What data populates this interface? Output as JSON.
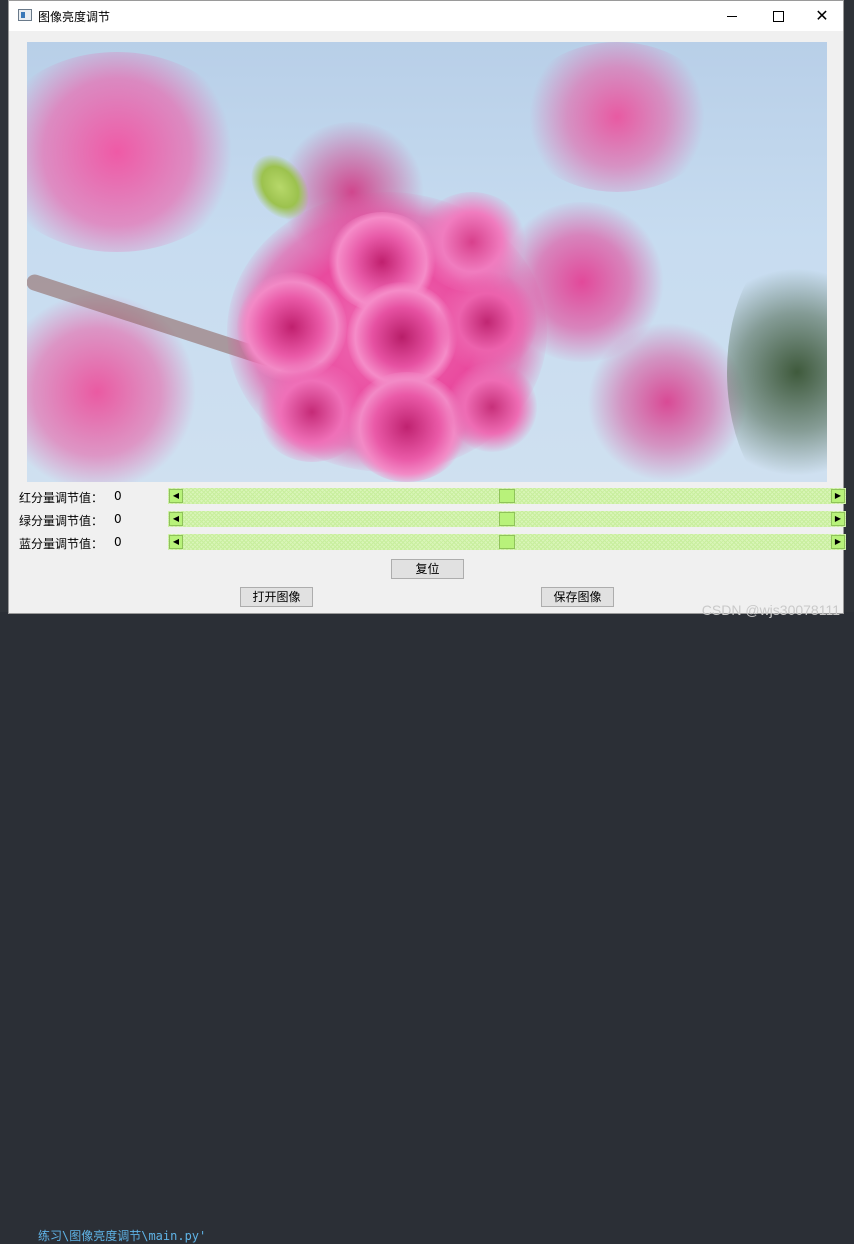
{
  "window": {
    "title": "图像亮度调节",
    "controls": {
      "minimize": "minimize-icon",
      "maximize": "maximize-icon",
      "close": "close-icon"
    }
  },
  "sliders": [
    {
      "label": "红分量调节值：",
      "value": "0",
      "position": 0.5
    },
    {
      "label": "绿分量调节值：",
      "value": "0",
      "position": 0.5
    },
    {
      "label": "蓝分量调节值：",
      "value": "0",
      "position": 0.5
    }
  ],
  "buttons": {
    "reset": "复位",
    "open": "打开图像",
    "save": "保存图像"
  },
  "background": {
    "ide_path_text": "练习\\图像亮度调节\\main.py'",
    "watermark": "CSDN @wjs30078111"
  },
  "colors": {
    "slider_accent": "#b8f27a",
    "slider_track": "#d9f5b8",
    "blossom": "#e0489a"
  }
}
